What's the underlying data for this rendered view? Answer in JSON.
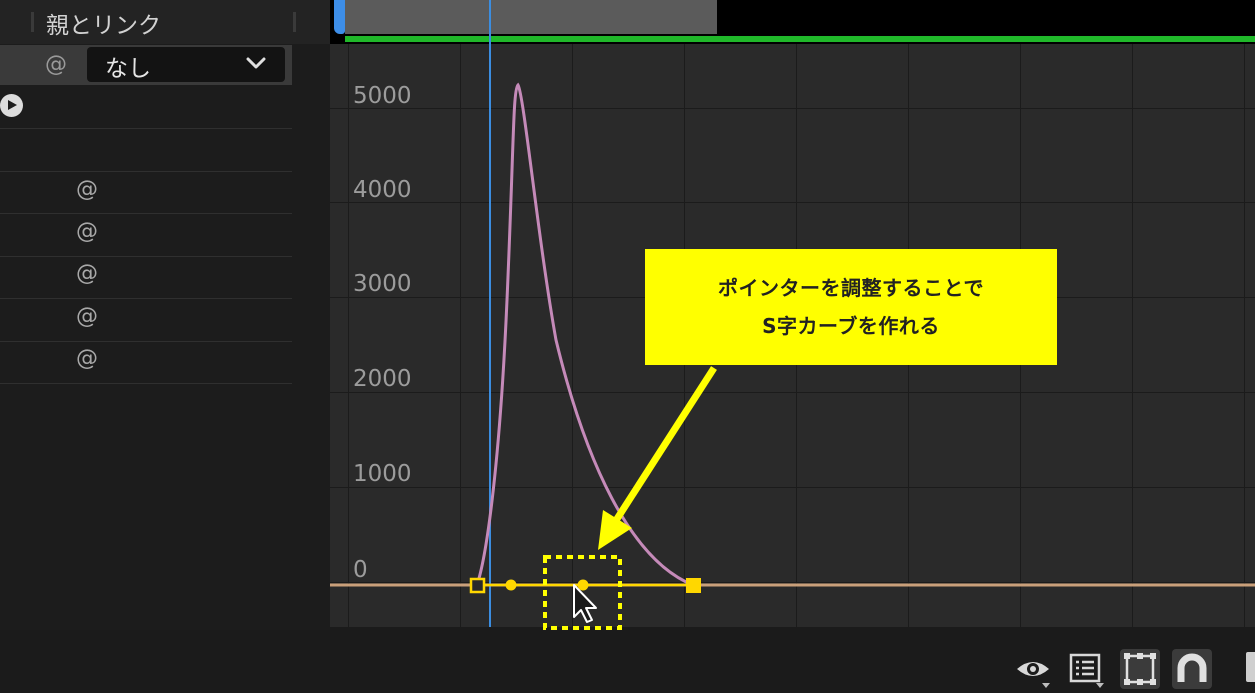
{
  "panel": {
    "header_label": "親とリンク",
    "dropdown_value": "なし"
  },
  "graph": {
    "y_labels": [
      "5000",
      "4000",
      "3000",
      "2000",
      "1000",
      "0"
    ]
  },
  "callout": {
    "line1": "ポインターを調整することで",
    "line2": "S字カーブを作れる"
  },
  "colors": {
    "curve": "#c58ab9",
    "keyframe": "#ffd700",
    "playhead": "#3b8de0",
    "work_area": "#20b82a",
    "callout_bg": "#ffff00"
  },
  "toolbar": {
    "icons": [
      "eye-icon",
      "list-icon",
      "frame-icon",
      "snap-magnet-icon"
    ]
  }
}
